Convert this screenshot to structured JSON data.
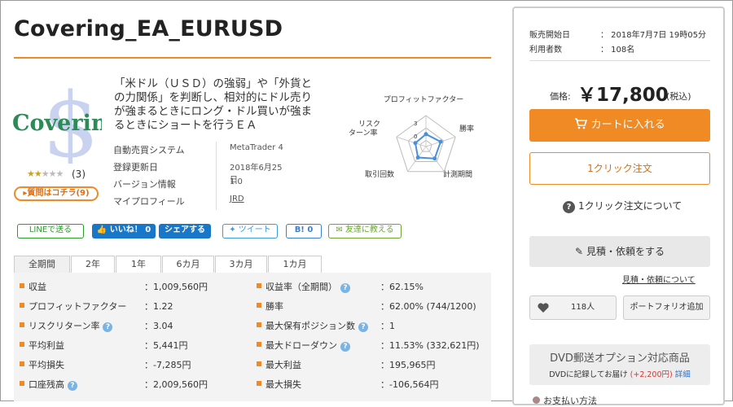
{
  "product": {
    "title": "Covering_EA_EURUSD",
    "logo_text": "Covering",
    "logo_symbol": "$",
    "rating": 2,
    "rating_max": 5,
    "rating_count": "(3)",
    "question_button": "質問はコチラ(9)",
    "description": "「米ドル（ＵＳＤ）の強弱」や「外貨との力関係」を判断し、相対的にドル売りが強まるときにロング・ドル買いが強まるときにショートを行うＥＡ",
    "info": [
      {
        "label": "自動売買システム",
        "value": "MetaTrader 4"
      },
      {
        "label": "登録更新日",
        "value": "2018年6月25日"
      },
      {
        "label": "バージョン情報",
        "value": "1.0"
      },
      {
        "label": "マイプロフィール",
        "value": "JRD"
      }
    ]
  },
  "radar": {
    "labels": [
      "プロフィットファクター",
      "勝率",
      "計測期間",
      "取引回数",
      "リスク\nターン率"
    ],
    "label_top": "プロフィットファクター",
    "label_winrate": "勝率",
    "label_period": "計測期間",
    "label_trades": "取引回数",
    "label_risk_1": "リスク",
    "label_risk_2": "ターン率",
    "tick_3": "3",
    "tick_0": "0",
    "values": [
      2.0,
      2.5,
      2.4,
      2.2,
      1.8
    ],
    "max": 5,
    "color": "#4a90d9"
  },
  "social": {
    "line": "LINEで送る",
    "like": "いいね！ 0",
    "share": "シェアする",
    "tweet": "ツイート",
    "hatena": "B! 0",
    "mail": "友達に教える"
  },
  "tabs": [
    "全期間",
    "2年",
    "1年",
    "6カ月",
    "3カ月",
    "1カ月"
  ],
  "stats": {
    "left": [
      {
        "label": "収益",
        "value": "1,009,560円",
        "help": false
      },
      {
        "label": "プロフィットファクター",
        "value": "1.22",
        "help": false
      },
      {
        "label": "リスクリターン率",
        "value": "3.04",
        "help": true
      },
      {
        "label": "平均利益",
        "value": "5,441円",
        "help": false
      },
      {
        "label": "平均損失",
        "value": "-7,285円",
        "help": false
      },
      {
        "label": "口座残高",
        "value": "2,009,560円",
        "help": true
      }
    ],
    "right": [
      {
        "label": "収益率（全期間）",
        "value": "62.15%",
        "help": true
      },
      {
        "label": "勝率",
        "value": "62.00% (744/1200)",
        "help": false
      },
      {
        "label": "最大保有ポジション数",
        "value": "1",
        "help": true
      },
      {
        "label": "最大ドローダウン",
        "value": "11.53% (332,621円)",
        "help": true
      },
      {
        "label": "最大利益",
        "value": "195,965円",
        "help": false
      },
      {
        "label": "最大損失",
        "value": "-106,564円",
        "help": false
      }
    ]
  },
  "sidebar": {
    "sale_start_label": "販売開始日",
    "sale_start_value": "：  2018年7月7日  19時05分",
    "users_label": "利用者数",
    "users_value": "：  108名",
    "price_label": "価格:",
    "price": "￥17,800",
    "price_tax": "(税込)",
    "cart_button": "カートに入れる",
    "oneclick_button": "1クリック注文",
    "oneclick_about": "1クリック注文について",
    "estimate_button": "見積・依頼をする",
    "estimate_link": "見積・依頼について",
    "favorite_count": "118人",
    "portfolio_button": "ポートフォリオ追加",
    "dvd_title": "DVD郵送オプション対応商品",
    "dvd_sub_1": "DVDに記録してお届け",
    "dvd_sub_price": "(+2,200円)",
    "dvd_sub_link": "詳細",
    "payment_heading": "お支払い方法"
  },
  "colors": {
    "accent": "#f08a24",
    "link": "#2a6fc9",
    "help": "#7ab4e3"
  }
}
